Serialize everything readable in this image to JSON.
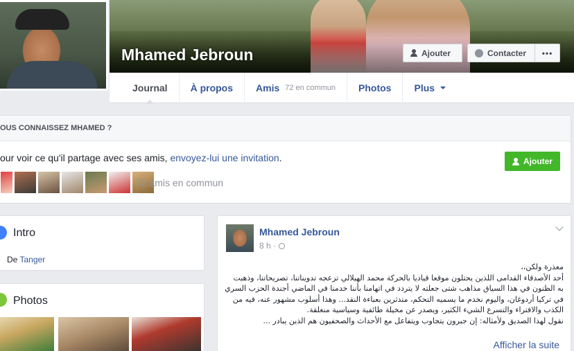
{
  "profile": {
    "name": "Mhamed Jebroun",
    "actions": {
      "add": "Ajouter",
      "contact": "Contacter",
      "more": "•••"
    }
  },
  "tabs": [
    {
      "label": "Journal",
      "sub": ""
    },
    {
      "label": "À propos",
      "sub": ""
    },
    {
      "label": "Amis",
      "sub": "72 en commun"
    },
    {
      "label": "Photos",
      "sub": ""
    },
    {
      "label": "Plus",
      "sub": ""
    }
  ],
  "know": {
    "heading": "OUS CONNAISSEZ MHAMED ?",
    "text_prefix": "our voir ce qu'il partage avec ses amis, ",
    "link": "envoyez-lui une invitation",
    "text_suffix": ".",
    "add_button": "Ajouter",
    "mutual": "72 amis en commun"
  },
  "intro": {
    "title": "Intro",
    "line_prefix": "De",
    "line_link": "Tanger"
  },
  "photos": {
    "title": "Photos"
  },
  "post": {
    "author": "Mhamed Jebroun",
    "time": "8 h ·",
    "body": [
      "معذرة ولكن،،",
      "أحد الأصدقاء القدامى اللذين يحتلون موقعا قياديا بالحركة محمد الهيلالي تزعجه تدويناتنا، تصريحاتنا، وذهبت",
      "به الظنون في هذا السياق مذاهب شتى جعلته لا يتردد في اتهامنا بأننا خدمنا في الماضي أجندة الحزب السري",
      "في تركيا أردوغان، واليوم نخدم ما يسميه التحكم، متدثرين بعباءة النقد... وهذا أسلوب مشهور عنه، فيه من",
      "الكذب والافتراء والتسرع الشيء الكثير، ويصدر عن مخيلة طائفية وسياسية منغلقة.",
      "نقول لهذا الصديق ولأمثاله: إن جبرون يتجاوب ويتفاعل مع الأحداث والصحفيون هم الذين يبادر ..."
    ],
    "see_more": "Afficher la suite"
  }
}
